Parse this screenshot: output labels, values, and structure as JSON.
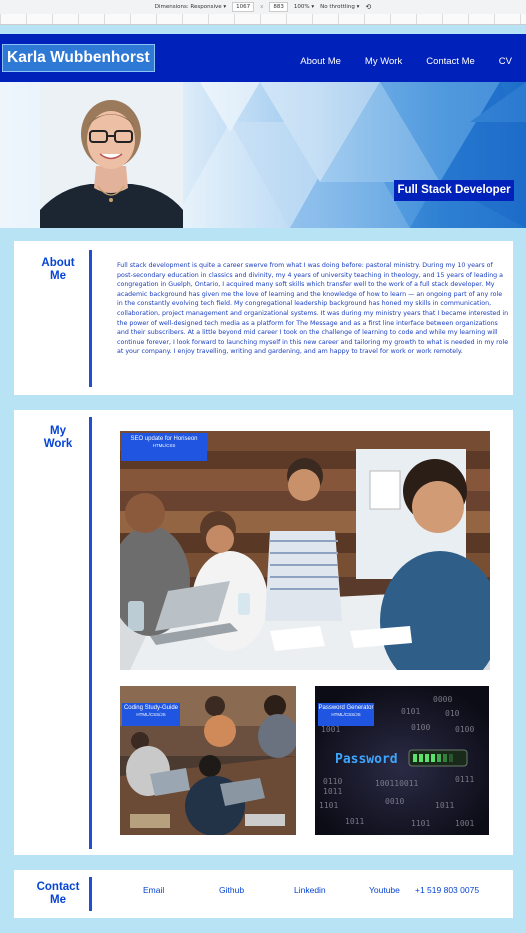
{
  "devtools": {
    "dimensions_label": "Dimensions: Responsive ▾",
    "width": "1067",
    "x": "x",
    "height": "883",
    "zoom": "100% ▾",
    "throttle": "No throttling ▾"
  },
  "header": {
    "brand": "Karla Wubbenhorst",
    "nav": [
      "About Me",
      "My Work",
      "Contact Me",
      "CV"
    ]
  },
  "hero": {
    "tagline": "Full Stack Developer"
  },
  "about": {
    "title_line1": "About",
    "title_line2": "Me",
    "text": "Full stack development is quite a career swerve from what I was doing before: pastoral ministry. During my 10 years of post-secondary education in classics and divinity, my 4 years of university teaching in theology, and 15 years of leading a congregation in Guelph, Ontario, I acquired many soft skills which transfer well to the work of a full stack developer. My academic background has given me the love of learning and the knowledge of how to learn — an ongoing part of any role in the constantly evolving tech field. My congregational leadership background has honed my skills in communication, collaboration, project management and organizational systems. It was during my ministry years that I became interested in the power of well-designed tech media as a platform for The Message and as a first line interface between organizations and their subscribers. At a little beyond mid career I took on the challenge of learning to code and while my learning will continue forever, I look forward to launching myself in this new career and tailoring my growth to what is needed in my role at your company. I enjoy travelling, writing and gardening, and am happy to travel for work or work remotely."
  },
  "work": {
    "title_line1": "My",
    "title_line2": "Work",
    "projects": [
      {
        "title": "SEO update for Horiseon",
        "tech": "HTML/CSS"
      },
      {
        "title": "Coding Study-Guide",
        "tech": "HTML/CSS/JS"
      },
      {
        "title": "Password Generator",
        "tech": "HTML/CSS/JS"
      }
    ],
    "password_word": "Password"
  },
  "contact": {
    "title_line1": "Contact",
    "title_line2": "Me",
    "links": [
      "Email",
      "Github",
      "Linkedin",
      "Youtube"
    ],
    "phone": "+1 519 803 0075"
  },
  "colors": {
    "header_bg": "#0022bb",
    "page_bg": "#b7e3f5",
    "accent_text": "#0645d4",
    "label_bg": "#1f55e0"
  }
}
